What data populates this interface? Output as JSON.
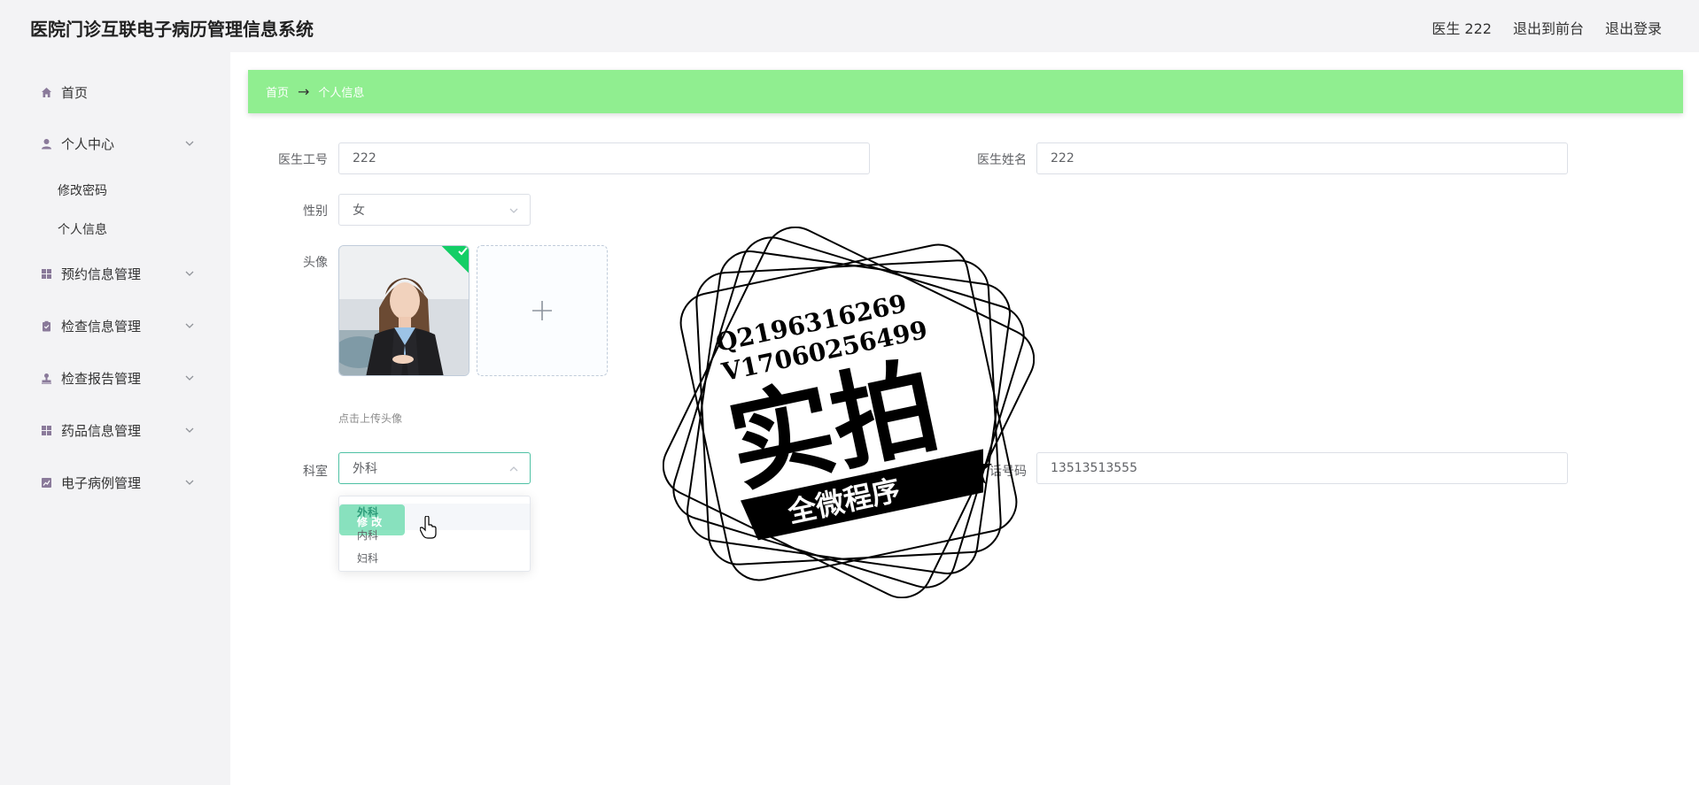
{
  "header": {
    "title": "医院门诊互联电子病历管理信息系统",
    "user": "医生 222",
    "to_front": "退出到前台",
    "logout": "退出登录"
  },
  "sidebar": {
    "items": [
      {
        "label": "首页",
        "icon": "home-icon"
      },
      {
        "label": "个人中心",
        "icon": "user-icon",
        "sub": [
          "修改密码",
          "个人信息"
        ]
      },
      {
        "label": "预约信息管理",
        "icon": "grid-icon"
      },
      {
        "label": "检查信息管理",
        "icon": "clipboard-icon"
      },
      {
        "label": "检查报告管理",
        "icon": "stamp-icon"
      },
      {
        "label": "药品信息管理",
        "icon": "grid-icon"
      },
      {
        "label": "电子病例管理",
        "icon": "chart-icon"
      }
    ]
  },
  "breadcrumb": {
    "home": "首页",
    "arrow": "→",
    "current": "个人信息"
  },
  "form": {
    "doctor_id_label": "医生工号",
    "doctor_id": "222",
    "doctor_name_label": "医生姓名",
    "doctor_name": "222",
    "gender_label": "性别",
    "gender": "女",
    "avatar_label": "头像",
    "upload_hint": "点击上传头像",
    "dept_label": "科室",
    "dept": "外科",
    "phone_label_visible": "话号码",
    "phone": "13513513555"
  },
  "dropdown": {
    "options": [
      "外科",
      "内科",
      "妇科"
    ],
    "edit_overlay": "修 改"
  },
  "watermark": {
    "line1": "Q2196316269",
    "line2": "V17060256499",
    "main": "实拍",
    "banner": "全微程序"
  },
  "colors": {
    "accent": "#90ee90",
    "select_border": "#4ec1a4",
    "check": "#13ce66"
  }
}
